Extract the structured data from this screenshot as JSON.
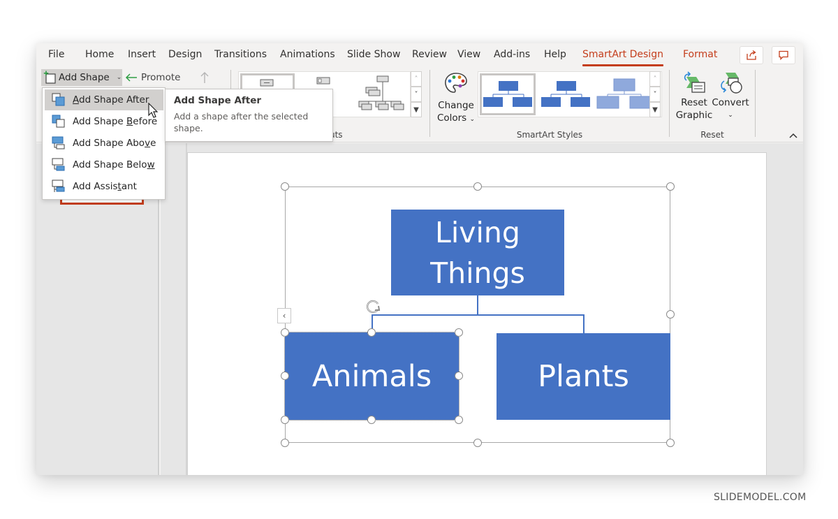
{
  "tabs": [
    {
      "label": "File"
    },
    {
      "label": "Home"
    },
    {
      "label": "Insert"
    },
    {
      "label": "Design"
    },
    {
      "label": "Transitions"
    },
    {
      "label": "Animations"
    },
    {
      "label": "Slide Show"
    },
    {
      "label": "Review"
    },
    {
      "label": "View"
    },
    {
      "label": "Add-ins"
    },
    {
      "label": "Help"
    },
    {
      "label": "SmartArt Design",
      "active": true
    },
    {
      "label": "Format"
    }
  ],
  "title_buttons": {
    "share_icon": "share-icon",
    "comments_icon": "comment-icon"
  },
  "ribbon": {
    "create_graphic": {
      "add_shape_label": "Add Shape",
      "promote_label": "Promote"
    },
    "layouts": {
      "group_label": "Layouts",
      "visible_label_fragment": "uts"
    },
    "smartart_styles": {
      "change_colors_line1": "Change",
      "change_colors_line2": "Colors",
      "group_label": "SmartArt Styles"
    },
    "reset": {
      "reset_graphic_line1": "Reset",
      "reset_graphic_line2": "Graphic",
      "convert_label": "Convert",
      "group_label": "Reset"
    }
  },
  "add_shape_menu": {
    "items": [
      {
        "label_pre": "",
        "label_ul": "A",
        "label_post": "dd Shape After",
        "hovered": true
      },
      {
        "label_pre": "Add Shape ",
        "label_ul": "B",
        "label_post": "efore"
      },
      {
        "label_pre": "Add Shape Abo",
        "label_ul": "v",
        "label_post": "e"
      },
      {
        "label_pre": "Add Shape Belo",
        "label_ul": "w",
        "label_post": ""
      },
      {
        "label_pre": "Add Assis",
        "label_ul": "t",
        "label_post": "ant"
      }
    ]
  },
  "tooltip": {
    "title": "Add Shape After",
    "body": "Add a shape after the selected shape."
  },
  "smartart": {
    "root": {
      "line1": "Living",
      "line2": "Things"
    },
    "children": [
      {
        "label": "Animals",
        "selected": true
      },
      {
        "label": "Plants"
      }
    ],
    "fill_color": "#4472c4"
  },
  "colors": {
    "accent": "#c43e1c",
    "node_blue": "#4472c4"
  },
  "watermark": "SLIDEMODEL.COM"
}
